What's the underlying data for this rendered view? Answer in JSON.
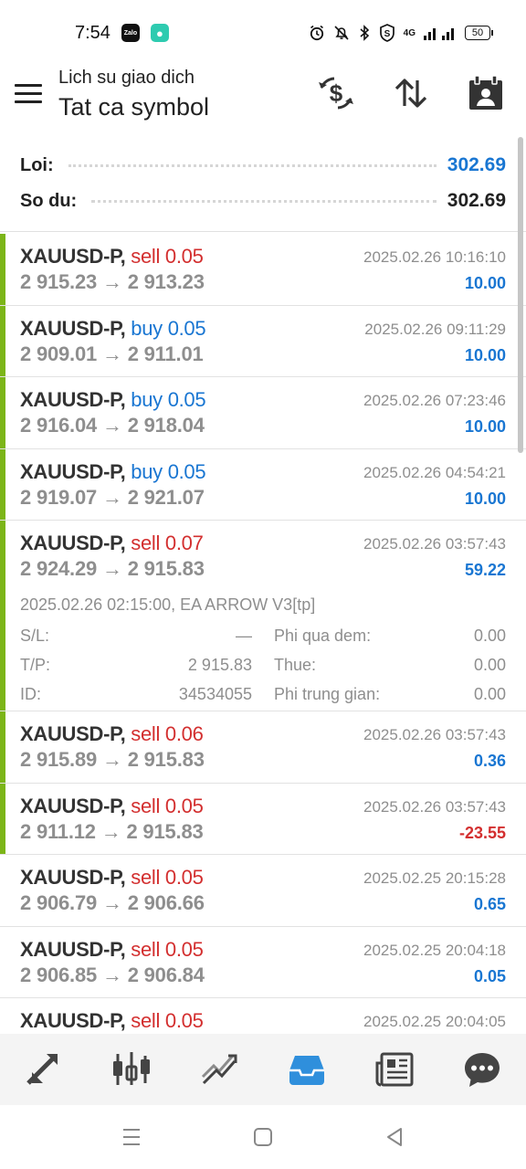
{
  "status_bar": {
    "time": "7:54",
    "apps": [
      "Zalo",
      "messenger"
    ],
    "network_label": "4G",
    "battery": "50"
  },
  "header": {
    "subtitle": "Lich su giao dich",
    "title": "Tat ca symbol"
  },
  "summary": {
    "profit_label": "Loi:",
    "profit_value": "302.69",
    "balance_label": "So du:",
    "balance_value": "302.69"
  },
  "deals": [
    {
      "symbol": "XAUUSD-P,",
      "side": "sell",
      "volume": "0.05",
      "open_price": "2 915.23",
      "close_price": "2 913.23",
      "time": "2025.02.26 10:16:10",
      "profit": "10.00",
      "accent": true
    },
    {
      "symbol": "XAUUSD-P,",
      "side": "buy",
      "volume": "0.05",
      "open_price": "2 909.01",
      "close_price": "2 911.01",
      "time": "2025.02.26 09:11:29",
      "profit": "10.00",
      "accent": true
    },
    {
      "symbol": "XAUUSD-P,",
      "side": "buy",
      "volume": "0.05",
      "open_price": "2 916.04",
      "close_price": "2 918.04",
      "time": "2025.02.26 07:23:46",
      "profit": "10.00",
      "accent": true
    },
    {
      "symbol": "XAUUSD-P,",
      "side": "buy",
      "volume": "0.05",
      "open_price": "2 919.07",
      "close_price": "2 921.07",
      "time": "2025.02.26 04:54:21",
      "profit": "10.00",
      "accent": true
    },
    {
      "symbol": "XAUUSD-P,",
      "side": "sell",
      "volume": "0.07",
      "open_price": "2 924.29",
      "close_price": "2 915.83",
      "time": "2025.02.26 03:57:43",
      "profit": "59.22",
      "accent": true,
      "details": {
        "open_info": "2025.02.26 02:15:00, EA ARROW V3[tp]",
        "sl_label": "S/L:",
        "sl_value": "—",
        "tp_label": "T/P:",
        "tp_value": "2 915.83",
        "id_label": "ID:",
        "id_value": "34534055",
        "swap_label": "Phi qua dem:",
        "swap_value": "0.00",
        "tax_label": "Thue:",
        "tax_value": "0.00",
        "commission_label": "Phi trung gian:",
        "commission_value": "0.00"
      }
    },
    {
      "symbol": "XAUUSD-P,",
      "side": "sell",
      "volume": "0.06",
      "open_price": "2 915.89",
      "close_price": "2 915.83",
      "time": "2025.02.26 03:57:43",
      "profit": "0.36",
      "accent": true
    },
    {
      "symbol": "XAUUSD-P,",
      "side": "sell",
      "volume": "0.05",
      "open_price": "2 911.12",
      "close_price": "2 915.83",
      "time": "2025.02.26 03:57:43",
      "profit": "-23.55",
      "accent": true
    },
    {
      "symbol": "XAUUSD-P,",
      "side": "sell",
      "volume": "0.05",
      "open_price": "2 906.79",
      "close_price": "2 906.66",
      "time": "2025.02.25 20:15:28",
      "profit": "0.65",
      "accent": false
    },
    {
      "symbol": "XAUUSD-P,",
      "side": "sell",
      "volume": "0.05",
      "open_price": "2 906.85",
      "close_price": "2 906.84",
      "time": "2025.02.25 20:04:18",
      "profit": "0.05",
      "accent": false
    },
    {
      "symbol": "XAUUSD-P,",
      "side": "sell",
      "volume": "0.05",
      "open_price": "",
      "close_price": "",
      "time": "2025.02.25 20:04:05",
      "profit": "",
      "accent": false
    }
  ],
  "arrow": "→",
  "colors": {
    "accent_green": "#7cb518",
    "sell_red": "#d32f2f",
    "buy_blue": "#1976d2",
    "active_tab": "#2f8fdc"
  },
  "bottom_nav": [
    "quotes-icon",
    "chart-icon",
    "trade-icon",
    "history-icon",
    "news-icon",
    "chat-icon"
  ]
}
